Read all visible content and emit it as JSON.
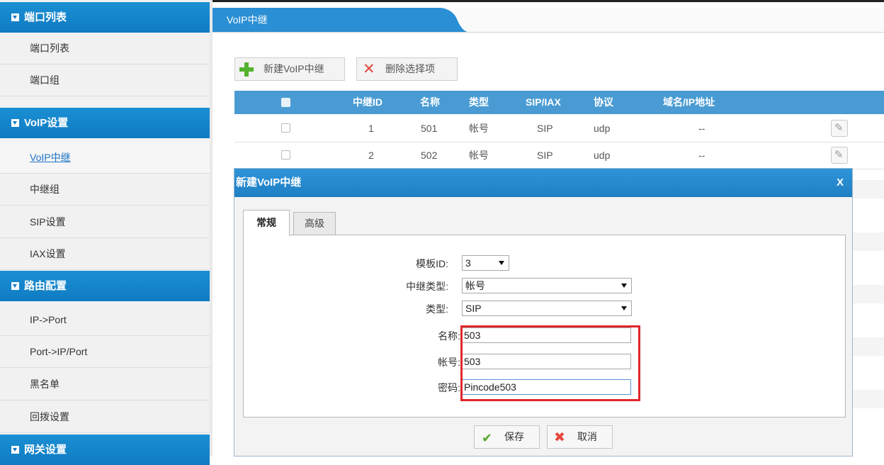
{
  "sidebar": {
    "sections": [
      {
        "label": "端口列表",
        "items": [
          "端口列表",
          "端口组"
        ]
      },
      {
        "label": "VoIP设置",
        "items": [
          "VoIP中继",
          "中继组",
          "SIP设置",
          "IAX设置"
        ]
      },
      {
        "label": "路由配置",
        "items": [
          "IP->Port",
          "Port->IP/Port",
          "黑名单",
          "回拨设置"
        ]
      },
      {
        "label": "网关设置",
        "items": []
      }
    ],
    "active_item": "VoIP中继"
  },
  "main": {
    "tab_title": "VoIP中继",
    "toolbar": {
      "new_label": "新建VoIP中继",
      "delete_label": "删除选择项"
    },
    "table": {
      "columns": [
        "",
        "中继ID",
        "名称",
        "类型",
        "SIP/IAX",
        "协议",
        "域名/IP地址"
      ],
      "rows": [
        {
          "id": "1",
          "name": "501",
          "type": "帐号",
          "proto_type": "SIP",
          "protocol": "udp",
          "address": "--"
        },
        {
          "id": "2",
          "name": "502",
          "type": "帐号",
          "proto_type": "SIP",
          "protocol": "udp",
          "address": "--"
        }
      ]
    }
  },
  "modal": {
    "title": "新建VoIP中继",
    "close_label": "X",
    "tabs": [
      "常规",
      "高级"
    ],
    "active_tab": "常规",
    "fields": {
      "template_id": {
        "label": "模板ID:",
        "value": "3"
      },
      "trunk_type": {
        "label": "中继类型:",
        "value": "帐号"
      },
      "type": {
        "label": "类型:",
        "value": "SIP"
      },
      "name": {
        "label": "名称:",
        "value": "503"
      },
      "account": {
        "label": "帐号:",
        "value": "503"
      },
      "password": {
        "label": "密码:",
        "value": "Pincode503"
      }
    },
    "save_label": "保存",
    "cancel_label": "取消"
  },
  "colors": {
    "accent": "#1b8fd3",
    "highlight": "#e0272b",
    "table_header": "#4a9bd3"
  }
}
